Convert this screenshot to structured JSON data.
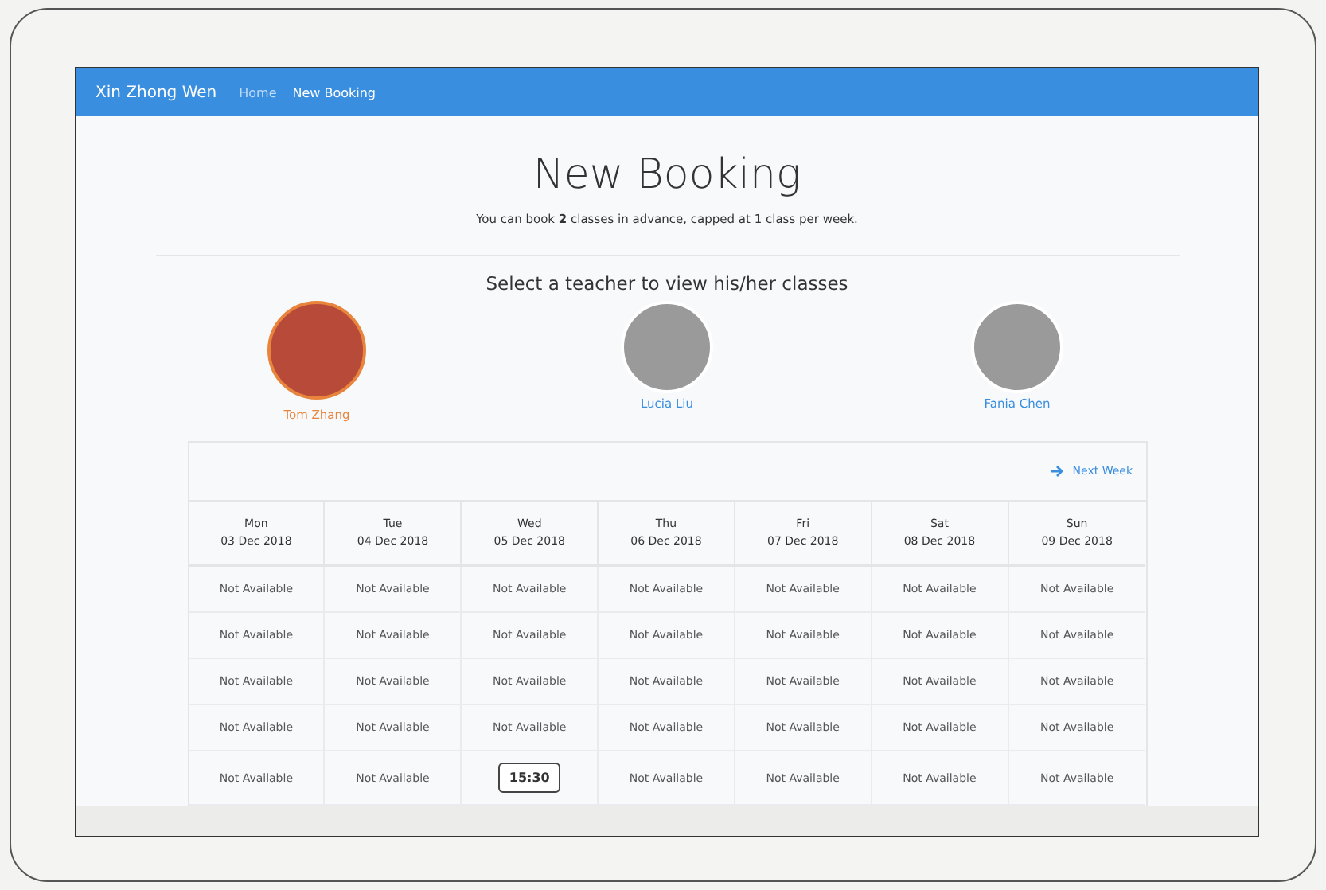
{
  "navbar": {
    "brand": "Xin Zhong Wen",
    "links": [
      {
        "label": "Home",
        "selected": false
      },
      {
        "label": "New Booking",
        "selected": true
      }
    ]
  },
  "heading": {
    "title": "New Booking",
    "subtitle": "You can book **2** classes in advance, capped at 1 class per week."
  },
  "teacher_prompt": "Select a teacher to view his/her classes",
  "teachers": [
    {
      "name": "Tom Zhang",
      "selected": true
    },
    {
      "name": "Lucia Liu",
      "selected": false
    },
    {
      "name": "Fania Chen",
      "selected": false
    }
  ],
  "schedule": {
    "next_week": "Next Week",
    "columns": [
      {
        "day": "Mon",
        "date": "03 Dec 2018"
      },
      {
        "day": "Tue",
        "date": "04 Dec 2018"
      },
      {
        "day": "Wed",
        "date": "05 Dec 2018"
      },
      {
        "day": "Thu",
        "date": "06 Dec 2018"
      },
      {
        "day": "Fri",
        "date": "07 Dec 2018"
      },
      {
        "day": "Sat",
        "date": "08 Dec 2018"
      },
      {
        "day": "Sun",
        "date": "09 Dec 2018"
      }
    ],
    "rows": [
      [
        {
          "kind": "unavailable",
          "text": "Not Available"
        },
        {
          "kind": "unavailable",
          "text": "Not Available"
        },
        {
          "kind": "unavailable",
          "text": "Not Available"
        },
        {
          "kind": "unavailable",
          "text": "Not Available"
        },
        {
          "kind": "unavailable",
          "text": "Not Available"
        },
        {
          "kind": "unavailable",
          "text": "Not Available"
        },
        {
          "kind": "unavailable",
          "text": "Not Available"
        }
      ],
      [
        {
          "kind": "unavailable",
          "text": "Not Available"
        },
        {
          "kind": "unavailable",
          "text": "Not Available"
        },
        {
          "kind": "unavailable",
          "text": "Not Available"
        },
        {
          "kind": "unavailable",
          "text": "Not Available"
        },
        {
          "kind": "unavailable",
          "text": "Not Available"
        },
        {
          "kind": "unavailable",
          "text": "Not Available"
        },
        {
          "kind": "unavailable",
          "text": "Not Available"
        }
      ],
      [
        {
          "kind": "unavailable",
          "text": "Not Available"
        },
        {
          "kind": "unavailable",
          "text": "Not Available"
        },
        {
          "kind": "unavailable",
          "text": "Not Available"
        },
        {
          "kind": "unavailable",
          "text": "Not Available"
        },
        {
          "kind": "unavailable",
          "text": "Not Available"
        },
        {
          "kind": "unavailable",
          "text": "Not Available"
        },
        {
          "kind": "unavailable",
          "text": "Not Available"
        }
      ],
      [
        {
          "kind": "unavailable",
          "text": "Not Available"
        },
        {
          "kind": "unavailable",
          "text": "Not Available"
        },
        {
          "kind": "unavailable",
          "text": "Not Available"
        },
        {
          "kind": "unavailable",
          "text": "Not Available"
        },
        {
          "kind": "unavailable",
          "text": "Not Available"
        },
        {
          "kind": "unavailable",
          "text": "Not Available"
        },
        {
          "kind": "unavailable",
          "text": "Not Available"
        }
      ],
      [
        {
          "kind": "unavailable",
          "text": "Not Available"
        },
        {
          "kind": "unavailable",
          "text": "Not Available"
        },
        {
          "kind": "slot",
          "text": "15:30"
        },
        {
          "kind": "unavailable",
          "text": "Not Available"
        },
        {
          "kind": "unavailable",
          "text": "Not Available"
        },
        {
          "kind": "unavailable",
          "text": "Not Available"
        },
        {
          "kind": "unavailable",
          "text": "Not Available"
        }
      ]
    ]
  }
}
